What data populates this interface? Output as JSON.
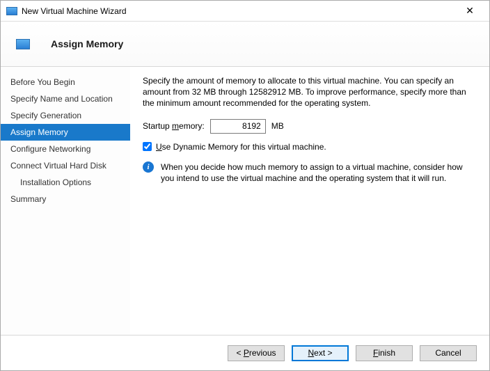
{
  "window": {
    "title": "New Virtual Machine Wizard",
    "close": "✕"
  },
  "header": {
    "title": "Assign Memory"
  },
  "sidebar": {
    "items": [
      {
        "label": "Before You Begin"
      },
      {
        "label": "Specify Name and Location"
      },
      {
        "label": "Specify Generation"
      },
      {
        "label": "Assign Memory"
      },
      {
        "label": "Configure Networking"
      },
      {
        "label": "Connect Virtual Hard Disk"
      },
      {
        "label": "Installation Options"
      },
      {
        "label": "Summary"
      }
    ]
  },
  "content": {
    "description": "Specify the amount of memory to allocate to this virtual machine. You can specify an amount from 32 MB through 12582912 MB. To improve performance, specify more than the minimum amount recommended for the operating system.",
    "startup_label_pre": "Startup ",
    "startup_label_ul": "m",
    "startup_label_post": "emory:",
    "startup_value": "8192",
    "startup_unit": "MB",
    "dynamic_pre": "",
    "dynamic_ul": "U",
    "dynamic_post": "se Dynamic Memory for this virtual machine.",
    "dynamic_checked": true,
    "info_text": "When you decide how much memory to assign to a virtual machine, consider how you intend to use the virtual machine and the operating system that it will run."
  },
  "footer": {
    "previous_pre": "< ",
    "previous_ul": "P",
    "previous_post": "revious",
    "next_ul": "N",
    "next_post": "ext >",
    "finish_ul": "F",
    "finish_post": "inish",
    "cancel": "Cancel"
  }
}
